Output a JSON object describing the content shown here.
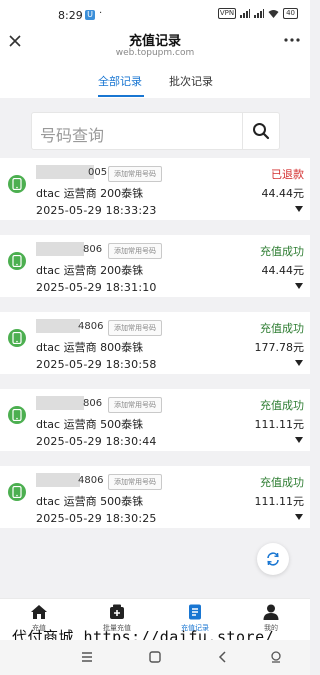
{
  "status_bar": {
    "time": "8:29",
    "app_icon": "U",
    "dot": "·",
    "vpn": "VPN",
    "battery": "40"
  },
  "nav": {
    "close_icon": "close-icon",
    "title": "充值记录",
    "subtitle": "web.topupm.com",
    "more_icon": "more-icon"
  },
  "tabs": [
    {
      "label": "全部记录",
      "active": true
    },
    {
      "label": "批次记录",
      "active": false
    }
  ],
  "search": {
    "placeholder": "号码查询",
    "button_icon": "search-icon"
  },
  "records": [
    {
      "number": "005",
      "tag": "添加常用号码",
      "operator": "dtac 运营商 200泰铢",
      "time": "2025-05-29 18:33:23",
      "status": "已退款",
      "status_color": "#d32f2f",
      "amount": "44.44元"
    },
    {
      "number": "806",
      "tag": "添加常用号码",
      "operator": "dtac 运营商 200泰铢",
      "time": "2025-05-29 18:31:10",
      "status": "充值成功",
      "status_color": "#2e7d32",
      "amount": "44.44元"
    },
    {
      "number": "4806",
      "tag": "添加常用号码",
      "operator": "dtac 运营商 800泰铢",
      "time": "2025-05-29 18:30:58",
      "status": "充值成功",
      "status_color": "#2e7d32",
      "amount": "177.78元"
    },
    {
      "number": "806",
      "tag": "添加常用号码",
      "operator": "dtac 运营商 500泰铢",
      "time": "2025-05-29 18:30:44",
      "status": "充值成功",
      "status_color": "#2e7d32",
      "amount": "111.11元"
    },
    {
      "number": "4806",
      "tag": "添加常用号码",
      "operator": "dtac 运营商 500泰铢",
      "time": "2025-05-29 18:30:25",
      "status": "充值成功",
      "status_color": "#2e7d32",
      "amount": "111.11元"
    }
  ],
  "bottom_nav": [
    {
      "label": "充值",
      "icon": "home-icon",
      "active": false
    },
    {
      "label": "批量充值",
      "icon": "batch-icon",
      "active": false
    },
    {
      "label": "充值记录",
      "icon": "records-icon",
      "active": true
    },
    {
      "label": "我的",
      "icon": "user-icon",
      "active": false
    }
  ],
  "watermark": "代付商城 https://daifu.store/",
  "colors": {
    "accent": "#1976d2",
    "success": "#2e7d32",
    "refunded": "#d32f2f",
    "icon_green": "#4caf50"
  }
}
